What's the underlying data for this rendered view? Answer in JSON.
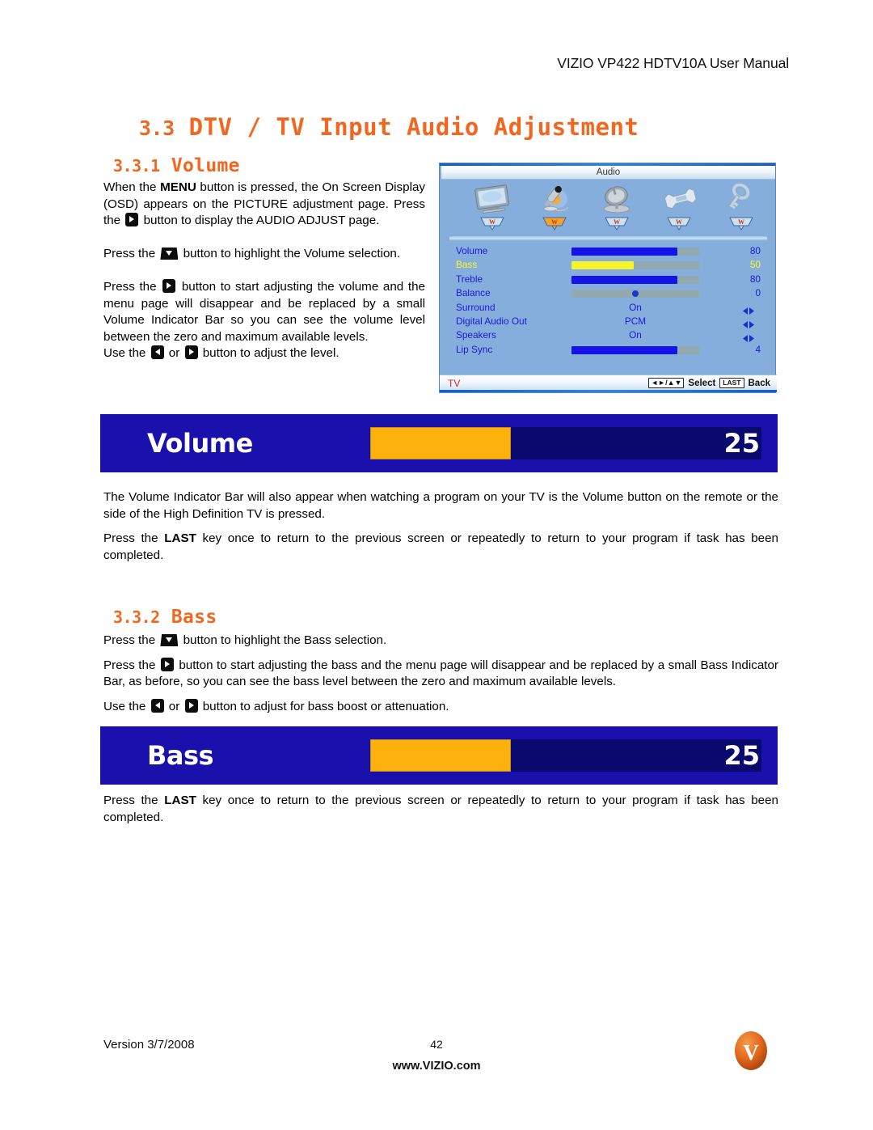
{
  "header": {
    "title": "VIZIO VP422 HDTV10A User Manual"
  },
  "headings": {
    "section_num": "3.3",
    "section_title": "DTV / TV Input Audio Adjustment",
    "sub1_num": "3.3.1",
    "sub1_title": "Volume",
    "sub2_num": "3.3.2",
    "sub2_title": "Bass"
  },
  "colors": {
    "heading_orange": "#F2671F",
    "osd_panel_bg": "#86AEDC",
    "osd_label_blue": "#1A1AD2",
    "osd_selected_yellow": "#FFF61A",
    "indicator_bg": "#1A11AD",
    "indicator_track": "#0A0A6E",
    "indicator_fill": "#FDB10C",
    "tv_red": "#E02020"
  },
  "volume_section": {
    "p1_a": "When the ",
    "p1_menu": "MENU",
    "p1_b": " button is pressed, the On Screen Display (OSD) appears on the PICTURE adjustment page.  Press the ",
    "p1_c": " button to display the AUDIO ADJUST page.",
    "p2_a": "Press the ",
    "p2_b": " button to highlight the Volume selection.",
    "p3_a": "Press the ",
    "p3_b": " button to start adjusting the volume and the menu page will disappear and be replaced by a small Volume Indicator Bar so you can see the volume level between the zero and maximum available levels.",
    "p4_a": "Use the ",
    "p4_or": " or ",
    "p4_b": " button to adjust the level.",
    "after_p1": "The Volume Indicator Bar will also appear when watching a program on your TV is the Volume button on the remote or the side of the High Definition TV is pressed.",
    "after_p2_a": "Press the ",
    "after_p2_last": "LAST",
    "after_p2_b": " key once to return to the previous screen or repeatedly to return to your program if task has been completed."
  },
  "bass_section": {
    "p1_a": "Press the ",
    "p1_b": " button to highlight the Bass selection.",
    "p2_a": "Press the ",
    "p2_b": " button to start adjusting the bass and the menu page will disappear and be replaced by a small Bass Indicator Bar, as before, so you can see the bass level between the zero and maximum available levels.",
    "p3_a": "Use the ",
    "p3_or": " or ",
    "p3_b": " button to adjust for bass boost or attenuation.",
    "after_p_a": "Press the ",
    "after_p_last": "LAST",
    "after_p_b": " key once to return to the previous screen or repeatedly to return to your program if task has been completed."
  },
  "osd": {
    "title": "Audio",
    "icons": [
      {
        "name": "picture-monitor-icon",
        "selected": false
      },
      {
        "name": "audio-microphone-icon",
        "selected": true
      },
      {
        "name": "tuner-satellite-dish-icon",
        "selected": false
      },
      {
        "name": "setup-wrench-icon",
        "selected": false
      },
      {
        "name": "parental-key-icon",
        "selected": false
      }
    ],
    "rows": [
      {
        "label": "Volume",
        "type": "slider",
        "value": "80",
        "percent": 83,
        "selected": false
      },
      {
        "label": "Bass",
        "type": "slider",
        "value": "50",
        "percent": 49,
        "selected": true
      },
      {
        "label": "Treble",
        "type": "slider",
        "value": "80",
        "percent": 83,
        "selected": false
      },
      {
        "label": "Balance",
        "type": "center",
        "value": "0",
        "percent": 50,
        "selected": false
      },
      {
        "label": "Surround",
        "type": "option",
        "value": "On",
        "selected": false
      },
      {
        "label": "Digital Audio Out",
        "type": "option",
        "value": "PCM",
        "selected": false
      },
      {
        "label": "Speakers",
        "type": "option",
        "value": "On",
        "selected": false
      },
      {
        "label": "Lip Sync",
        "type": "slider",
        "value": "4",
        "percent": 83,
        "selected": false
      }
    ],
    "footer": {
      "input": "TV",
      "nav_keycap": "◄►/▲▼",
      "select_label": "Select",
      "last_keycap": "LAST",
      "back_label": "Back"
    }
  },
  "indicators": [
    {
      "label": "Volume",
      "value": "25",
      "percent": 36
    },
    {
      "label": "Bass",
      "value": "25",
      "percent": 36
    }
  ],
  "footer": {
    "version": "Version 3/7/2008",
    "page": "42",
    "site": "www.VIZIO.com",
    "logo_letter": "V"
  }
}
